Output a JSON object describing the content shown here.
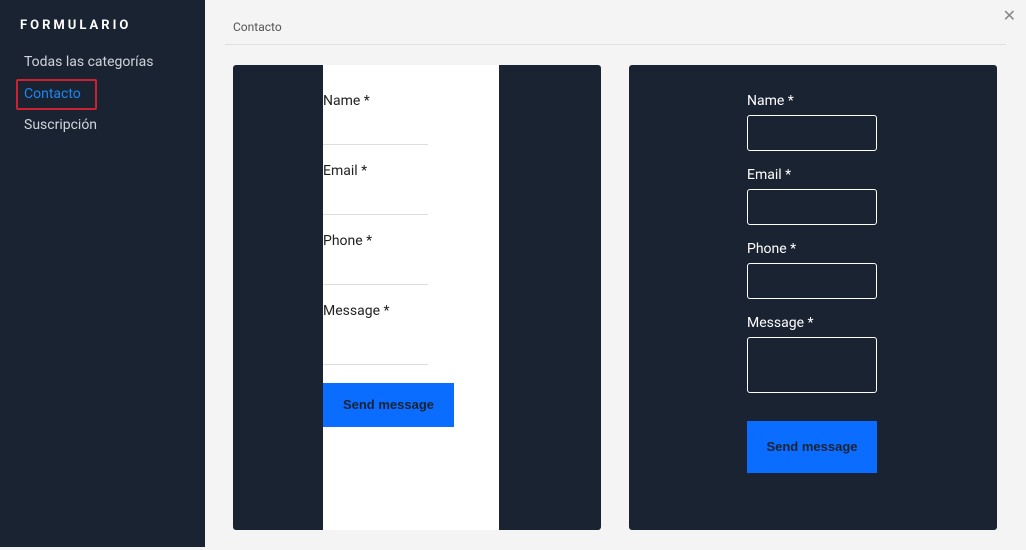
{
  "sidebar": {
    "title": "FORMULARIO",
    "items": [
      {
        "label": "Todas las categorías"
      },
      {
        "label": "Contacto"
      },
      {
        "label": "Suscripción"
      }
    ]
  },
  "header": {
    "breadcrumb": "Contacto"
  },
  "form_light": {
    "name_label": "Name *",
    "email_label": "Email *",
    "phone_label": "Phone *",
    "message_label": "Message *",
    "submit_label": "Send message"
  },
  "form_dark": {
    "name_label": "Name *",
    "email_label": "Email *",
    "phone_label": "Phone *",
    "message_label": "Message *",
    "submit_label": "Send message"
  }
}
